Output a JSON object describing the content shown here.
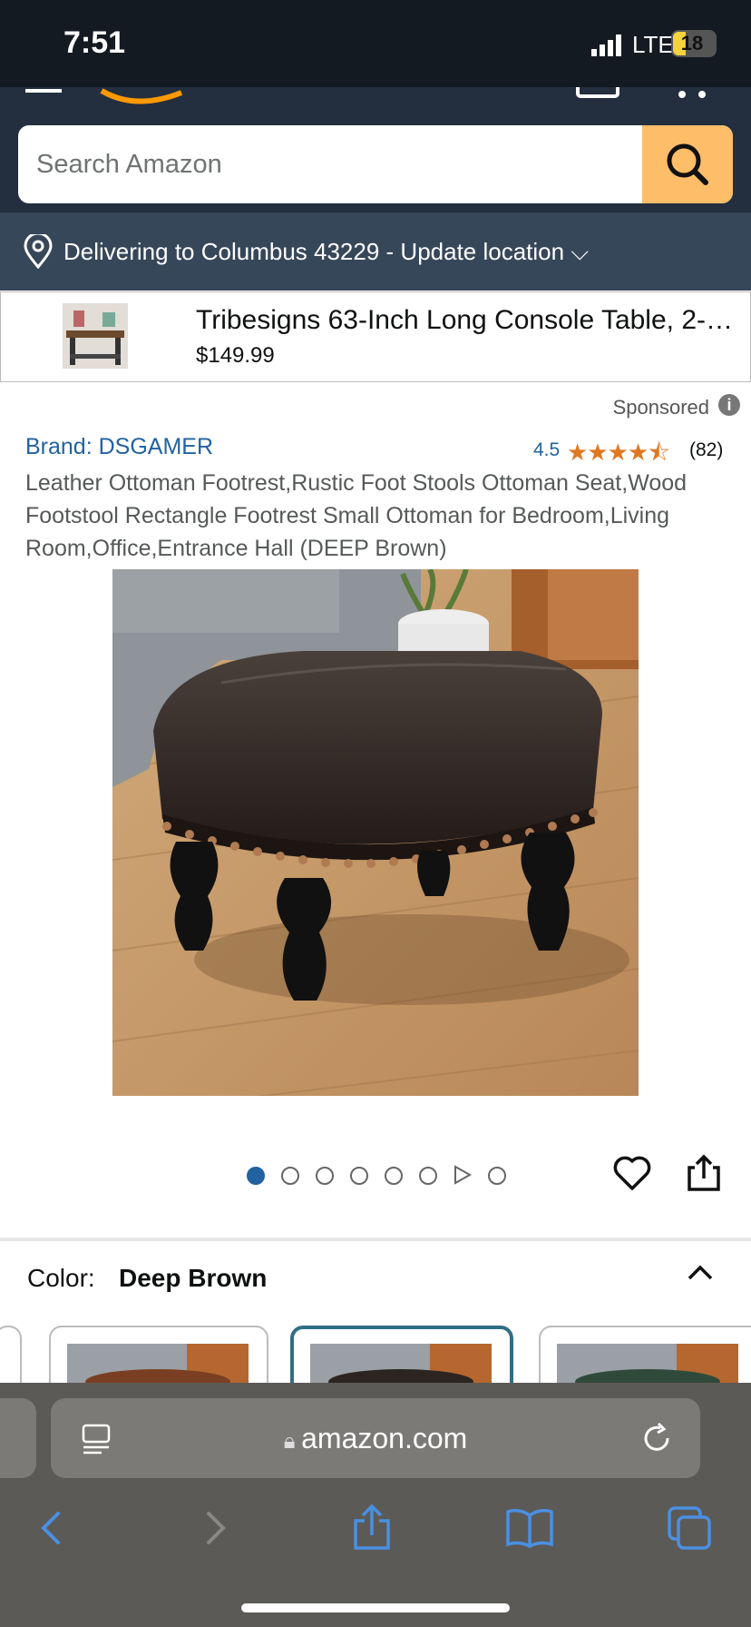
{
  "status_bar": {
    "time": "7:51",
    "network": "LTE",
    "battery": "18"
  },
  "search": {
    "placeholder": "Search Amazon"
  },
  "delivery": {
    "text": "Delivering to Columbus 43229 - Update location ⌵"
  },
  "sponsored_banner": {
    "title": "Tribesigns 63-Inch Long Console Table, 2-…",
    "price": "$149.99"
  },
  "sponsored_label": "Sponsored",
  "product": {
    "brand": "Brand: DSGAMER",
    "rating": "4.5",
    "rating_stars": 4.5,
    "rating_count": "(82)",
    "title": "Leather Ottoman Footrest,Rustic Foot Stools Ottoman Seat,Wood Footstool Rectangle Footrest Small Ottoman for Bedroom,Living Room,Office,Entrance Hall (DEEP Brown)",
    "image_count": 8,
    "current_image": 1
  },
  "color": {
    "label": "Color:",
    "value": "Deep Brown"
  },
  "browser": {
    "url": "amazon.com"
  },
  "colors": {
    "header": "#232f3e",
    "deliver": "#37475a",
    "search_button": "#febd69",
    "link": "#2162a1",
    "star": "#de7921"
  }
}
